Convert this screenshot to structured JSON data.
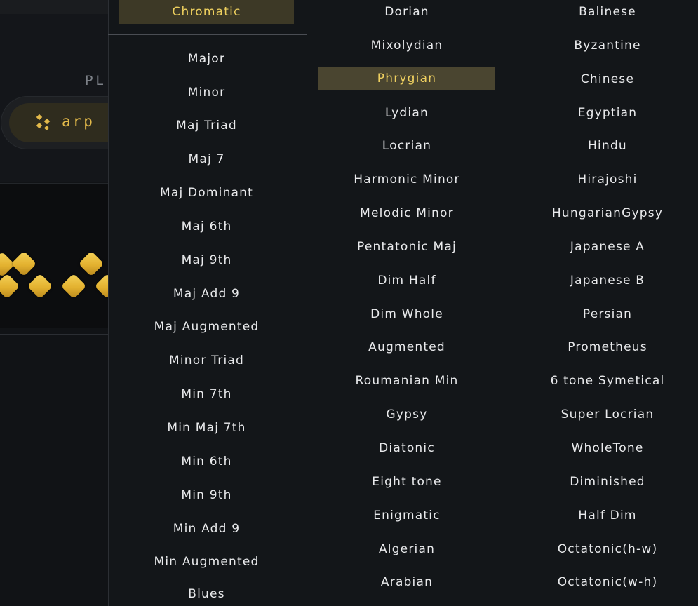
{
  "background": {
    "play_label": "PL",
    "arp_button_label": "arp",
    "arp_icon": "sparkle-icon",
    "accent_color": "#e2b94a"
  },
  "menu": {
    "selected_color": "#edcf5e",
    "columns": [
      {
        "items": [
          "Chromatic",
          "Major",
          "Minor",
          "Maj Triad",
          "Maj 7",
          "Maj Dominant",
          "Maj 6th",
          "Maj 9th",
          "Maj Add 9",
          "Maj Augmented",
          "Minor Triad",
          "Min 7th",
          "Min Maj 7th",
          "Min 6th",
          "Min 9th",
          "Min Add 9",
          "Min Augmented",
          "Blues"
        ]
      },
      {
        "items": [
          "Dorian",
          "Mixolydian",
          "Phrygian",
          "Lydian",
          "Locrian",
          "Harmonic Minor",
          "Melodic Minor",
          "Pentatonic Maj",
          "Dim Half",
          "Dim Whole",
          "Augmented",
          "Roumanian Min",
          "Gypsy",
          "Diatonic",
          "Eight tone",
          "Enigmatic",
          "Algerian",
          "Arabian"
        ],
        "selected": "Phrygian"
      },
      {
        "items": [
          "Balinese",
          "Byzantine",
          "Chinese",
          "Egyptian",
          "Hindu",
          "Hirajoshi",
          "HungarianGypsy",
          "Japanese A",
          "Japanese B",
          "Persian",
          "Prometheus",
          "6 tone Symetical",
          "Super Locrian",
          "WholeTone",
          "Diminished",
          "Half Dim",
          "Octatonic(h-w)",
          "Octatonic(w-h)"
        ]
      }
    ]
  }
}
